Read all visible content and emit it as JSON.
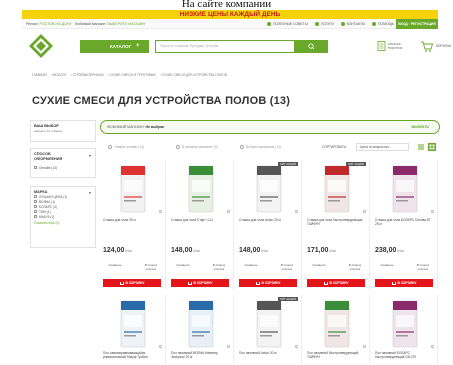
{
  "caption": "На сайте компании",
  "promo": {
    "text": "НИЗКИЕ ЦЕНЫ КАЖДЫЙ ДЕНЬ"
  },
  "topnav": {
    "region_prefix": "Регион: ",
    "region": "РОСТОВ-НА-ДОНУ",
    "store_prefix": "Любимый магазин: ",
    "store": "ВЫБЕРИТЕ МАГАЗИН",
    "links": [
      "ПОЛЕЗНЫЕ СОВЕТЫ",
      "УСЛУГИ",
      "КОНТАКТЫ",
      "ПОМОЩЬ"
    ],
    "login": "ВХОД · РЕГИСТРАЦИЯ"
  },
  "header": {
    "logo": "LEROY MERLIN",
    "catalog_label": "КАТАЛОГ",
    "search_placeholder": "Поиск по товарам, брендам, услугам",
    "compare_label": "СПИСОК ПОКУПОК",
    "cart_label": "КОРЗИНА"
  },
  "breadcrumbs": [
    "ГЛАВНАЯ",
    "КАТАЛОГ",
    "СТРОЙМАТЕРИАЛЫ",
    "СУХИЕ СМЕСИ И ГРУНТОВКИ",
    "СУХИЕ СМЕСИ ДЛЯ УСТРОЙСТВА ПОЛОВ"
  ],
  "page_title": "СУХИЕ СМЕСИ ДЛЯ УСТРОЙСТВА ПОЛОВ (13)",
  "sidebar": {
    "selection_title": "ВАШ ВЫБОР",
    "selection_sub": "найдено 13 товаров",
    "options_title": "СПОСОБ ОФОРМЛЕНИЯ",
    "options": [
      "Онлайн (13)"
    ],
    "brand_title": "МАРКА",
    "brands": [
      "ЛУЧШАЯ ЦЕНА (1)",
      "ВОЛМА (1)",
      "БОЛАРС (4)",
      "TИM (1)",
      "КНАУФ (1)"
    ],
    "show_more": "Показать ещё (4)"
  },
  "store_bar": {
    "label": "ЛЮБИМЫЙ МАГАЗИН: ",
    "value": "Не выбран",
    "action": "ВЫБРАТЬ"
  },
  "filters": {
    "online": "Товары онлайн (13)",
    "in_store": "В наличии магазине (0)",
    "all_stores": "Во всех магазинах (13)",
    "sort_label": "СОРТИРОВАТЬ:",
    "sort_value": "Цена по возрастан..."
  },
  "products_row1": [
    {
      "name": "Стяжка для пола 25 кг",
      "price": "124,00",
      "unit": "₽/шт",
      "color": "#f2f2f2",
      "stripe": "#d33",
      "hit": false
    },
    {
      "name": "Стяжка для пола Старт Ч-11",
      "price": "148,00",
      "unit": "₽/шт",
      "color": "#e7f0e2",
      "stripe": "#3a8e3a",
      "hit": false
    },
    {
      "name": "Стяжка для пола Axton 25 кг",
      "price": "148,00",
      "unit": "₽/шт",
      "color": "#f3f3f3",
      "stripe": "#555",
      "hit": true
    },
    {
      "name": "Стяжка для пола быстротвердеющая ТАЙФУН",
      "price": "171,00",
      "unit": "₽/шт",
      "color": "#f0e6e6",
      "stripe": "#c02a2a",
      "hit": true
    },
    {
      "name": "Стяжка для пола БОЛАРС Основа БТ 25 кг",
      "price": "238,00",
      "unit": "₽/шт",
      "color": "#efe4ec",
      "stripe": "#8a2a6a",
      "hit": false
    }
  ],
  "products_row2": [
    {
      "name": "Пол самовыравнивающийся универсальный Кнауф Трибон",
      "color": "#eef3f7",
      "stripe": "#2a6aa8",
      "hit": false
    },
    {
      "name": "Пол наливной ВОЛМА Нивелир Экспресс 20 кг",
      "color": "#e7f0f7",
      "stripe": "#2a6aa8",
      "hit": false
    },
    {
      "name": "Пол наливной Axton 20 кг",
      "color": "#f3f3f3",
      "stripe": "#555",
      "hit": true
    },
    {
      "name": "Пол наливной быстротвердеющий ТАЙФУН",
      "color": "#f0e6e6",
      "stripe": "#3a8e3a",
      "hit": false
    },
    {
      "name": "Пол наливной БОЛАРС быстротвердеющий СВ-270",
      "color": "#efe4ec",
      "stripe": "#8a2a6a",
      "hit": false
    }
  ],
  "card_actions": {
    "compare": "Сравнить",
    "in_list": "В список покупок",
    "buy": "В КОРЗИНУ",
    "hit": "ХИТ АКЦИЯ"
  },
  "colors": {
    "brand_green": "#6aa82c",
    "promo_yellow": "#f5d20a",
    "buy_red": "#e3141a"
  }
}
